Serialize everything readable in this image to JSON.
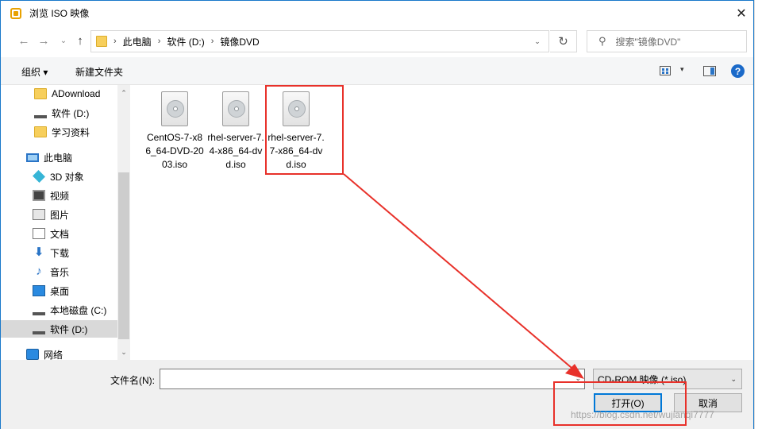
{
  "window": {
    "title": "浏览 ISO 映像",
    "close_glyph": "✕"
  },
  "nav": {
    "back_glyph": "←",
    "forward_glyph": "→",
    "recent_glyph": "⌄",
    "up_glyph": "↑",
    "breadcrumbs": [
      "此电脑",
      "软件 (D:)",
      "镜像DVD"
    ],
    "separator": "›",
    "dropdown_glyph": "⌄",
    "refresh_glyph": "↻",
    "search_placeholder": "搜索\"镜像DVD\"",
    "search_icon": "search-icon"
  },
  "toolbar": {
    "organize_label": "组织 ▾",
    "new_folder_label": "新建文件夹",
    "view_dropdown_glyph": "▾",
    "help_glyph": "?"
  },
  "sidebar": {
    "items": [
      {
        "label": "ADownload",
        "icon": "folder-icon"
      },
      {
        "label": "软件 (D:)",
        "icon": "drive-icon"
      },
      {
        "label": "学习资料",
        "icon": "folder-icon"
      },
      {
        "label": "此电脑",
        "icon": "computer-icon"
      },
      {
        "label": "3D 对象",
        "icon": "3d-objects-icon"
      },
      {
        "label": "视频",
        "icon": "video-icon"
      },
      {
        "label": "图片",
        "icon": "pictures-icon"
      },
      {
        "label": "文档",
        "icon": "documents-icon"
      },
      {
        "label": "下载",
        "icon": "download-icon"
      },
      {
        "label": "音乐",
        "icon": "music-icon"
      },
      {
        "label": "桌面",
        "icon": "desktop-icon"
      },
      {
        "label": "本地磁盘 (C:)",
        "icon": "drive-icon"
      },
      {
        "label": "软件 (D:)",
        "icon": "drive-icon",
        "selected": true
      },
      {
        "label": "网络",
        "icon": "network-icon"
      }
    ],
    "scroll_up_glyph": "⌃",
    "scroll_down_glyph": "⌄",
    "download_glyph": "⬇",
    "music_glyph": "♪"
  },
  "files": [
    {
      "name": "CentOS-7-x86_64-DVD-2003.iso",
      "icon": "disc-image-icon"
    },
    {
      "name": "rhel-server-7.4-x86_64-dvd.iso",
      "icon": "disc-image-icon"
    },
    {
      "name": "rhel-server-7.7-x86_64-dvd.iso",
      "icon": "disc-image-icon",
      "highlighted": true
    }
  ],
  "bottom": {
    "filename_label": "文件名(N):",
    "filename_value": "",
    "filter_value": "CD-ROM 映像 (*.iso)",
    "dropdown_glyph": "⌄",
    "open_label": "打开(O)",
    "cancel_label": "取消"
  },
  "watermark": "https://blog.csdn.net/wujianqi7777",
  "colors": {
    "annotation_red": "#e8312a",
    "accent_blue": "#0078d7"
  }
}
